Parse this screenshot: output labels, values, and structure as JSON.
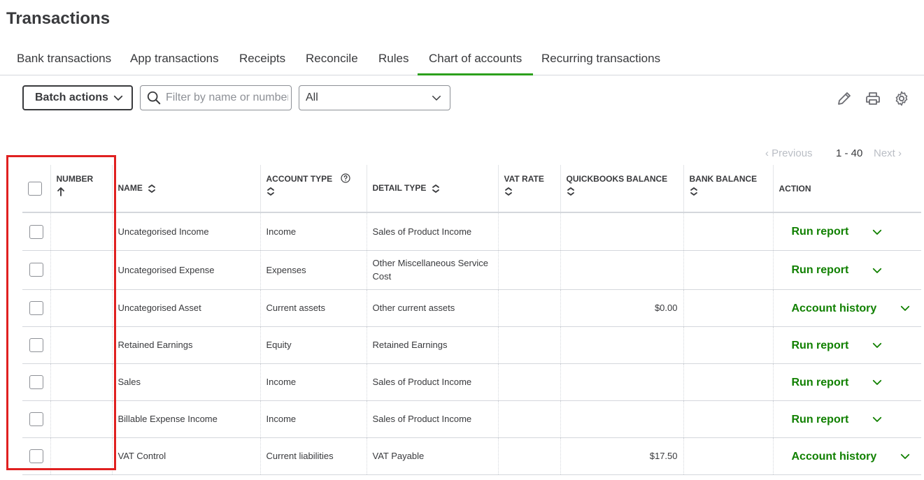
{
  "page": {
    "title": "Transactions"
  },
  "tabs": [
    {
      "label": "Bank transactions",
      "active": false
    },
    {
      "label": "App transactions",
      "active": false
    },
    {
      "label": "Receipts",
      "active": false
    },
    {
      "label": "Reconcile",
      "active": false
    },
    {
      "label": "Rules",
      "active": false
    },
    {
      "label": "Chart of accounts",
      "active": true
    },
    {
      "label": "Recurring transactions",
      "active": false
    }
  ],
  "toolbar": {
    "batch_label": "Batch actions",
    "search_placeholder": "Filter by name or number",
    "filter_value": "All",
    "icons": [
      "edit-icon",
      "print-icon",
      "settings-icon"
    ]
  },
  "pager": {
    "prev": "Previous",
    "range": "1 - 40",
    "next": "Next"
  },
  "columns": {
    "number": "NUMBER",
    "name": "NAME",
    "account_type": "ACCOUNT TYPE",
    "detail_type": "DETAIL TYPE",
    "vat_rate": "VAT RATE",
    "qb_balance": "QUICKBOOKS BALANCE",
    "bank_balance": "BANK BALANCE",
    "action": "ACTION"
  },
  "rows": [
    {
      "number": "",
      "name": "Uncategorised Income",
      "account_type": "Income",
      "detail_type": "Sales of Product Income",
      "vat_rate": "",
      "qb_balance": "",
      "bank_balance": "",
      "action": "Run report"
    },
    {
      "number": "",
      "name": "Uncategorised Expense",
      "account_type": "Expenses",
      "detail_type": "Other Miscellaneous Service Cost",
      "vat_rate": "",
      "qb_balance": "",
      "bank_balance": "",
      "action": "Run report"
    },
    {
      "number": "",
      "name": "Uncategorised Asset",
      "account_type": "Current assets",
      "detail_type": "Other current assets",
      "vat_rate": "",
      "qb_balance": "$0.00",
      "bank_balance": "",
      "action": "Account history"
    },
    {
      "number": "",
      "name": "Retained Earnings",
      "account_type": "Equity",
      "detail_type": "Retained Earnings",
      "vat_rate": "",
      "qb_balance": "",
      "bank_balance": "",
      "action": "Run report"
    },
    {
      "number": "",
      "name": "Sales",
      "account_type": "Income",
      "detail_type": "Sales of Product Income",
      "vat_rate": "",
      "qb_balance": "",
      "bank_balance": "",
      "action": "Run report"
    },
    {
      "number": "",
      "name": "Billable Expense Income",
      "account_type": "Income",
      "detail_type": "Sales of Product Income",
      "vat_rate": "",
      "qb_balance": "",
      "bank_balance": "",
      "action": "Run report"
    },
    {
      "number": "",
      "name": "VAT Control",
      "account_type": "Current liabilities",
      "detail_type": "VAT Payable",
      "vat_rate": "",
      "qb_balance": "$17.50",
      "bank_balance": "",
      "action": "Account history"
    }
  ],
  "colors": {
    "accent_green": "#2ca01c",
    "action_green": "#108000",
    "highlight_red": "#e02020"
  }
}
